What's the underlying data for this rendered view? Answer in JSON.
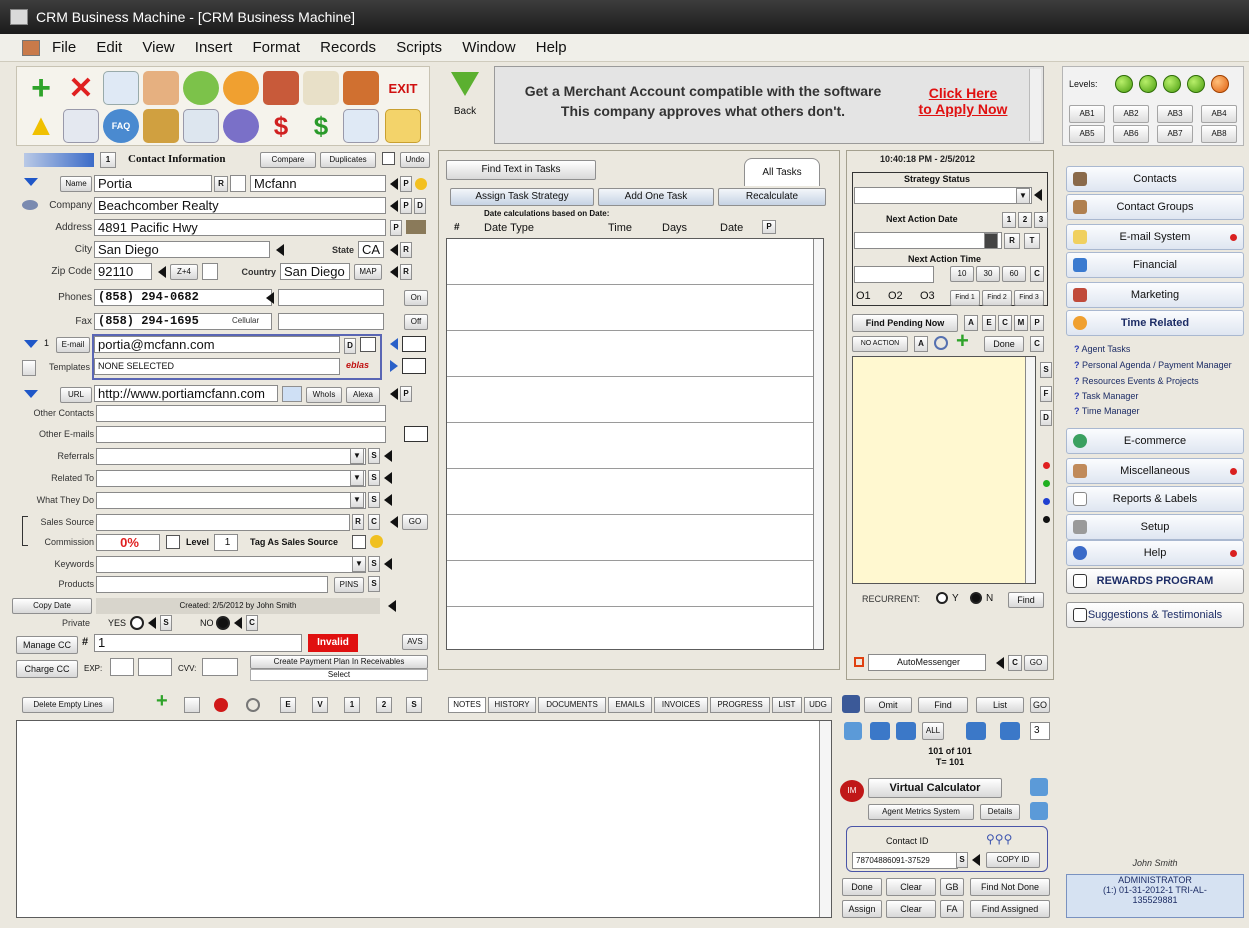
{
  "window": {
    "title": "CRM Business Machine - [CRM Business Machine]"
  },
  "menu": [
    "File",
    "Edit",
    "View",
    "Insert",
    "Format",
    "Records",
    "Scripts",
    "Window",
    "Help"
  ],
  "toolbar": {
    "exit_label": "EXIT",
    "back_label": "Back"
  },
  "ad": {
    "message_line1": "Get a Merchant Account compatible with the software",
    "message_line2": "This company approves what others don't.",
    "cta_line1": "Click Here",
    "cta_line2": "to Apply Now"
  },
  "levels": {
    "label": "Levels:",
    "dots": [
      "1",
      "2",
      "3",
      "4",
      "5"
    ],
    "buttons": [
      "AB1",
      "AB2",
      "AB3",
      "AB4",
      "AB5",
      "AB6",
      "AB7",
      "AB8"
    ]
  },
  "contact": {
    "section_title": "Contact Information",
    "compare": "Compare",
    "duplicates": "Duplicates",
    "undo": "Undo",
    "count": "1",
    "name_label": "Name",
    "first_name": "Portia",
    "last_name": "Mcfann",
    "company_label": "Company",
    "company": "Beachcomber Realty",
    "address_label": "Address",
    "address": "4891 Pacific Hwy",
    "city_label": "City",
    "city": "San Diego",
    "state_label": "State",
    "state": "CA",
    "zip_label": "Zip Code",
    "zip": "92110",
    "zip4": "Z+4",
    "country_label": "Country",
    "country": "San Diego",
    "map": "MAP",
    "phones_label": "Phones",
    "phone": "(858) 294-0682",
    "fax_label": "Fax",
    "fax": "(858) 294-1695",
    "cellular_label": "Cellular",
    "on": "On",
    "off": "Off",
    "email_num": "1",
    "email_label": "E-mail",
    "email": "portia@mcfann.com",
    "templates_label": "Templates",
    "templates": "NONE SELECTED",
    "url_label": "URL",
    "url": "http://www.portiamcfann.com",
    "whois": "WhoIs",
    "alexa": "Alexa",
    "other_contacts_label": "Other Contacts",
    "other_emails_label": "Other E-mails",
    "referrals_label": "Referrals",
    "related_label": "Related To",
    "what_label": "What They Do",
    "sales_source_label": "Sales Source",
    "go": "GO",
    "commission_label": "Commission",
    "commission": "0%",
    "level_label": "Level",
    "level": "1",
    "tag_label": "Tag As Sales Source",
    "keywords_label": "Keywords",
    "products_label": "Products",
    "pins": "PINS",
    "copy_date": "Copy Date",
    "created": "Created: 2/5/2012 by John Smith",
    "private_label": "Private",
    "yes": "YES",
    "no": "NO",
    "manage_cc": "Manage CC",
    "cc_num": "1",
    "invalid": "Invalid",
    "avs": "AVS",
    "charge_cc": "Charge CC",
    "exp": "EXP:",
    "cvv": "CVV:",
    "payment_plan": "Create Payment Plan In Receivables",
    "select": "Select"
  },
  "tasks": {
    "find_text": "Find Text in Tasks",
    "all_tasks": "All Tasks",
    "assign_strategy": "Assign Task Strategy",
    "add_one": "Add One Task",
    "recalculate": "Recalculate",
    "date_calc": "Date calculations based on Date:",
    "cols": [
      "#",
      "Date Type",
      "Time",
      "Days",
      "Date",
      "P"
    ]
  },
  "strategy": {
    "datetime": "10:40:18 PM - 2/5/2012",
    "status_label": "Strategy Status",
    "next_action_date": "Next Action Date",
    "nums": [
      "1",
      "2",
      "3"
    ],
    "r": "R",
    "t": "T",
    "next_action_time": "Next Action Time",
    "times": [
      "10",
      "30",
      "60"
    ],
    "c": "C",
    "radios": [
      "O1",
      "O2",
      "O3"
    ],
    "finds": [
      "Find 1",
      "Find 2",
      "Find 3"
    ],
    "find_pending": "Find Pending Now",
    "letters": [
      "A",
      "E",
      "C",
      "M",
      "P"
    ],
    "no_action": "NO ACTION",
    "a": "A",
    "done": "Done",
    "side_letters": [
      "S",
      "F",
      "D"
    ],
    "recurrent": "RECURRENT:",
    "y": "Y",
    "n": "N",
    "find": "Find",
    "automessenger": "AutoMessenger",
    "go": "GO"
  },
  "bottom": {
    "delete_empty": "Delete Empty Lines",
    "numbuttons": [
      "E",
      "V",
      "1",
      "2",
      "S"
    ],
    "tabs": [
      "NOTES",
      "HISTORY",
      "DOCUMENTS",
      "EMAILS",
      "INVOICES",
      "PROGRESS",
      "LIST",
      "UDG"
    ],
    "omit": "Omit",
    "find": "Find",
    "list": "List",
    "go": "GO",
    "all": "ALL",
    "page": "3",
    "record": "101 of 101",
    "total": "T= 101",
    "virtual_calc": "Virtual Calculator",
    "agent_metrics": "Agent Metrics System",
    "details": "Details",
    "contact_id_label": "Contact ID",
    "contact_id": "78704886091-37529",
    "copy_id": "COPY ID",
    "done": "Done",
    "clear": "Clear",
    "gb": "GB",
    "find_not_done": "Find Not Done",
    "assign": "Assign",
    "fa": "FA",
    "find_assigned": "Find Assigned"
  },
  "nav": {
    "items": [
      "Contacts",
      "Contact Groups",
      "E-mail System",
      "Financial",
      "Marketing",
      "Time Related"
    ],
    "sublinks": [
      "Agent Tasks",
      "Personal Agenda / Payment Manager",
      "Resources Events & Projects",
      "Task Manager",
      "Time Manager"
    ],
    "items2": [
      "E-commerce",
      "Miscellaneous",
      "Reports & Labels",
      "Setup",
      "Help",
      "REWARDS PROGRAM",
      "Suggestions & Testimonials"
    ],
    "user": "John Smith",
    "role": "ADMINISTRATOR",
    "license": "(1:) 01-31-2012-1 TRI-AL-",
    "license2": "135529881"
  }
}
